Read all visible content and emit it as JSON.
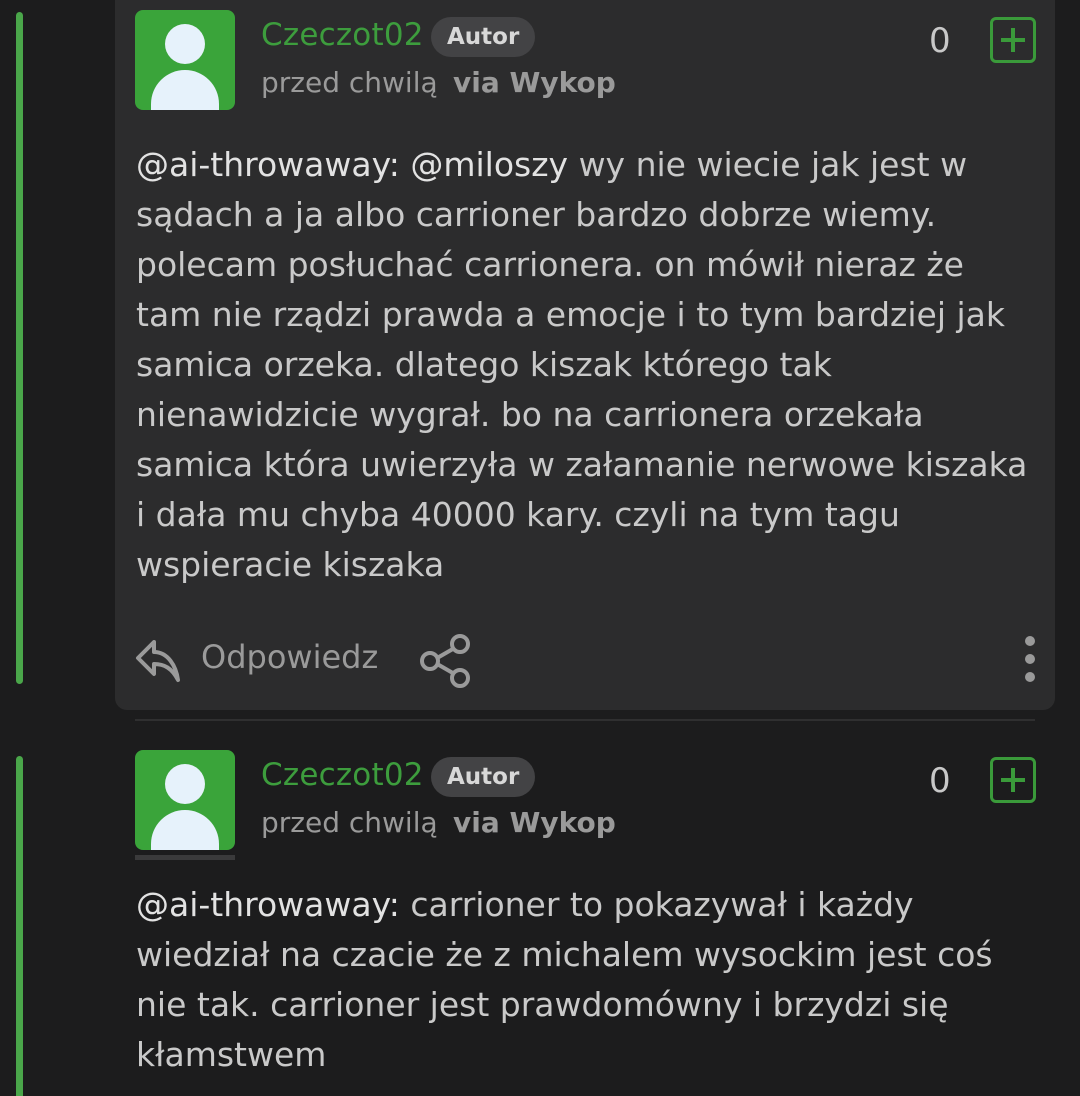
{
  "comments": [
    {
      "username": "Czeczot02",
      "badge": "Autor",
      "time": "przed chwilą",
      "via": "via Wykop",
      "score": "0",
      "mention1": "@ai-throwaway:",
      "mention2": "@miloszy",
      "text": " wy nie wiecie jak jest w sądach a ja albo carrioner bardzo dobrze wiemy. polecam posłuchać carrionera. on mówił nieraz że tam nie rządzi prawda a emocje i to tym bardziej jak samica orzeka. dlatego kiszak którego tak nienawidzicie wygrał. bo na carrionera orzekała samica która uwierzyła w załamanie nerwowe kiszaka i dała mu chyba 40000 kary. czyli na tym tagu wspieracie kiszaka",
      "reply_label": "Odpowiedz"
    },
    {
      "username": "Czeczot02",
      "badge": "Autor",
      "time": "przed chwilą",
      "via": "via Wykop",
      "score": "0",
      "mention1": "@ai-throwaway:",
      "text": " carrioner to pokazywał i każdy wiedział na czacie że z michalem wysockim jest coś nie tak. carrioner jest prawdomówny i brzydzi się kłamstwem"
    }
  ],
  "icons": {
    "avatar": "default-user-avatar",
    "plus": "plus-icon",
    "reply": "reply-arrow-icon",
    "share": "share-icon",
    "more": "more-vertical-icon"
  },
  "colors": {
    "background": "#1c1c1d",
    "card": "#2c2c2d",
    "accent_green": "#3aa43a",
    "username_green": "#3d9d3d",
    "text": "#c9c9c9",
    "muted": "#9a9a9a"
  }
}
